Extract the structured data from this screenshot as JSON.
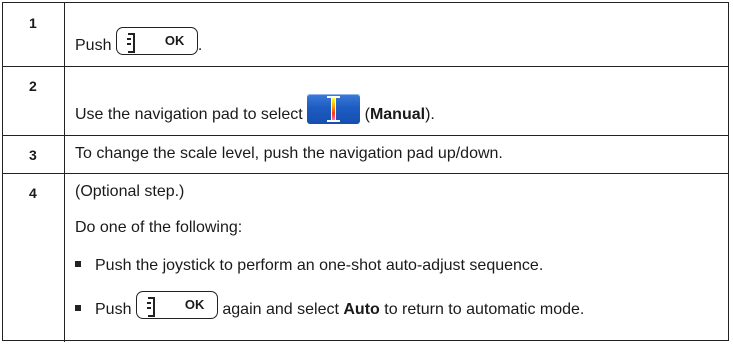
{
  "steps": [
    {
      "number": "1",
      "text_before": "Push",
      "button_label": "OK",
      "text_after": "."
    },
    {
      "number": "2",
      "text_before": "Use the navigation pad to select",
      "icon_label": "Manual",
      "text_after_open": "(",
      "text_after_close": ")."
    },
    {
      "number": "3",
      "text": "To change the scale level, push the navigation pad up/down."
    },
    {
      "number": "4",
      "optional_note": "(Optional step.)",
      "intro": "Do one of the following:",
      "bullets": [
        {
          "text": "Push the joystick to perform an one-shot auto-adjust sequence."
        },
        {
          "text_before": "Push",
          "button_label": "OK",
          "text_middle": "again and select",
          "bold_word": "Auto",
          "text_after": "to return to automatic mode."
        }
      ]
    }
  ],
  "icons": {
    "ok_button": "bracket-ok-button-icon",
    "manual": "manual-scale-icon"
  },
  "colors": {
    "manual_icon_blue": "#1d5cc2",
    "border": "#222222"
  }
}
